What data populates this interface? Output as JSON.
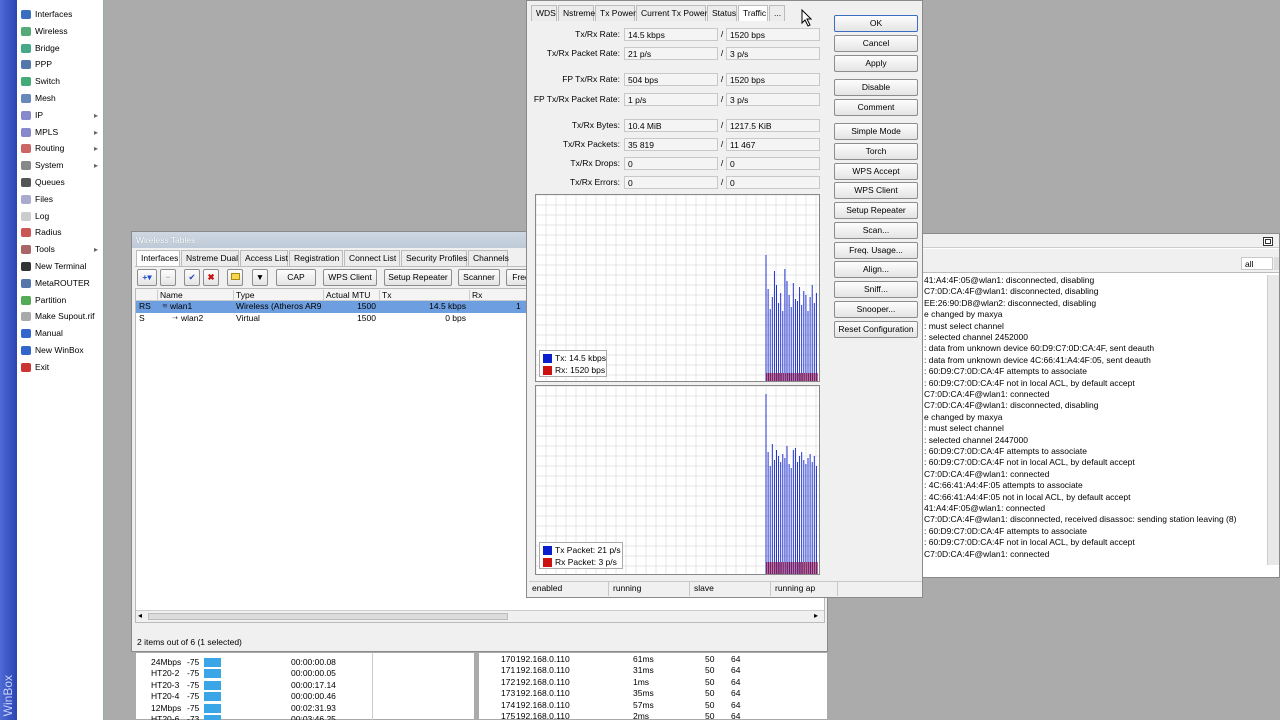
{
  "app_label": "WinBox",
  "menu": {
    "items": [
      {
        "label": "Interfaces",
        "arrow": false,
        "color": "#3a6ec0"
      },
      {
        "label": "Wireless",
        "arrow": false,
        "color": "#5a7"
      },
      {
        "label": "Bridge",
        "arrow": false,
        "color": "#4a8"
      },
      {
        "label": "PPP",
        "arrow": false,
        "color": "#57a"
      },
      {
        "label": "Switch",
        "arrow": false,
        "color": "#4a7"
      },
      {
        "label": "Mesh",
        "arrow": false,
        "color": "#68b"
      },
      {
        "label": "IP",
        "arrow": true,
        "color": "#88c"
      },
      {
        "label": "MPLS",
        "arrow": true,
        "color": "#88c"
      },
      {
        "label": "Routing",
        "arrow": true,
        "color": "#c66"
      },
      {
        "label": "System",
        "arrow": true,
        "color": "#888"
      },
      {
        "label": "Queues",
        "arrow": false,
        "color": "#555"
      },
      {
        "label": "Files",
        "arrow": false,
        "color": "#aac"
      },
      {
        "label": "Log",
        "arrow": false,
        "color": "#ccc"
      },
      {
        "label": "Radius",
        "arrow": false,
        "color": "#c55"
      },
      {
        "label": "Tools",
        "arrow": true,
        "color": "#a66"
      },
      {
        "label": "New Terminal",
        "arrow": false,
        "color": "#333"
      },
      {
        "label": "MetaROUTER",
        "arrow": false,
        "color": "#57a"
      },
      {
        "label": "Partition",
        "arrow": false,
        "color": "#5a5"
      },
      {
        "label": "Make Supout.rif",
        "arrow": false,
        "color": "#aaa"
      },
      {
        "label": "Manual",
        "arrow": false,
        "color": "#36c"
      },
      {
        "label": "New WinBox",
        "arrow": false,
        "color": "#36c"
      },
      {
        "label": "Exit",
        "arrow": false,
        "color": "#c33"
      }
    ]
  },
  "wireless_tables": {
    "title": "Wireless Tables",
    "tabs": [
      "Interfaces",
      "Nstreme Dual",
      "Access List",
      "Registration",
      "Connect List",
      "Security Profiles",
      "Channels"
    ],
    "toolbar": {
      "cap": "CAP",
      "wps_client": "WPS Client",
      "setup_repeater": "Setup Repeater",
      "scanner": "Scanner",
      "freq": "Freq"
    },
    "columns": [
      "Name",
      "Type",
      "Actual MTU",
      "Tx",
      "Rx"
    ],
    "rows": [
      {
        "flags": "RS",
        "name": "wlan1",
        "type": "Wireless (Atheros AR9...",
        "mtu": "1500",
        "tx": "14.5 kbps",
        "rx": "1"
      },
      {
        "flags": "S",
        "name": "wlan2",
        "type": "Virtual",
        "mtu": "1500",
        "tx": "0 bps",
        "rx": ""
      }
    ],
    "status": "2 items out of 6 (1 selected)"
  },
  "iface_window": {
    "tabs": [
      "WDS",
      "Nstreme",
      "Tx Power",
      "Current Tx Power",
      "Status",
      "Traffic",
      "..."
    ],
    "fields": [
      {
        "label": "Tx/Rx Rate:",
        "tx": "14.5 kbps",
        "rx": "1520 bps"
      },
      {
        "label": "Tx/Rx Packet Rate:",
        "tx": "21 p/s",
        "rx": "3 p/s"
      },
      {
        "label": "FP Tx/Rx Rate:",
        "tx": "504 bps",
        "rx": "1520 bps"
      },
      {
        "label": "FP Tx/Rx Packet Rate:",
        "tx": "1 p/s",
        "rx": "3 p/s"
      },
      {
        "label": "Tx/Rx Bytes:",
        "tx": "10.4 MiB",
        "rx": "1217.5 KiB"
      },
      {
        "label": "Tx/Rx Packets:",
        "tx": "35 819",
        "rx": "11 467"
      },
      {
        "label": "Tx/Rx Drops:",
        "tx": "0",
        "rx": "0"
      },
      {
        "label": "Tx/Rx Errors:",
        "tx": "0",
        "rx": "0"
      }
    ],
    "slash": "/",
    "graph1_legend": {
      "tx": "Tx:  14.5 kbps",
      "rx": "Rx:  1520 bps"
    },
    "graph2_legend": {
      "tx": "Tx Packet:  21 p/s",
      "rx": "Rx Packet:  3 p/s"
    },
    "buttons": [
      "OK",
      "Cancel",
      "Apply",
      "Disable",
      "Comment",
      "Simple Mode",
      "Torch",
      "WPS Accept",
      "WPS Client",
      "Setup Repeater",
      "Scan...",
      "Freq. Usage...",
      "Align...",
      "Sniff...",
      "Snooper...",
      "Reset Configuration"
    ],
    "status": [
      "enabled",
      "running",
      "slave",
      "running ap"
    ],
    "colors": {
      "tx": "#0a1fcc",
      "rx": "#cc1111"
    }
  },
  "log_window": {
    "filter_value": "all",
    "lines": [
      "41:A4:4F:05@wlan1: disconnected, disabling",
      "C7:0D:CA:4F@wlan1: disconnected, disabling",
      "EE:26:90:D8@wlan2: disconnected, disabling",
      "e changed by maxya",
      ": must select channel",
      ": selected channel 2452000",
      ": data from unknown device 60:D9:C7:0D:CA:4F, sent deauth",
      ": data from unknown device 4C:66:41:A4:4F:05, sent deauth",
      ": 60:D9:C7:0D:CA:4F attempts to associate",
      ": 60:D9:C7:0D:CA:4F not in local ACL, by default accept",
      "C7:0D:CA:4F@wlan1: connected",
      "C7:0D:CA:4F@wlan1: disconnected, disabling",
      "e changed by maxya",
      ": must select channel",
      ": selected channel 2447000",
      ": 60:D9:C7:0D:CA:4F attempts to associate",
      ": 60:D9:C7:0D:CA:4F not in local ACL, by default accept",
      "C7:0D:CA:4F@wlan1: connected",
      ": 4C:66:41:A4:4F:05 attempts to associate",
      ": 4C:66:41:A4:4F:05 not in local ACL, by default accept",
      "41:A4:4F:05@wlan1: connected",
      "C7:0D:CA:4F@wlan1: disconnected, received disassoc: sending station leaving (8)",
      ": 60:D9:C7:0D:CA:4F attempts to associate",
      ": 60:D9:C7:0D:CA:4F not in local ACL, by default accept",
      "C7:0D:CA:4F@wlan1: connected"
    ]
  },
  "bottom_left_rows": [
    {
      "rate": "24Mbps",
      "signal": "-75",
      "time": "00:00:00.08"
    },
    {
      "rate": "HT20-2",
      "signal": "-75",
      "time": "00:00:00.05"
    },
    {
      "rate": "HT20-3",
      "signal": "-75",
      "time": "00:00:17.14"
    },
    {
      "rate": "HT20-4",
      "signal": "-75",
      "time": "00:00:00.46"
    },
    {
      "rate": "12Mbps",
      "signal": "-75",
      "time": "00:02:31.93"
    },
    {
      "rate": "HT20-6",
      "signal": "-73",
      "time": "00:03:46.25"
    }
  ],
  "bottom_right_rows": [
    {
      "seq": "170",
      "host": "192.168.0.110",
      "time": "61ms",
      "size": "50",
      "ttl": "64"
    },
    {
      "seq": "171",
      "host": "192.168.0.110",
      "time": "31ms",
      "size": "50",
      "ttl": "64"
    },
    {
      "seq": "172",
      "host": "192.168.0.110",
      "time": "1ms",
      "size": "50",
      "ttl": "64"
    },
    {
      "seq": "173",
      "host": "192.168.0.110",
      "time": "35ms",
      "size": "50",
      "ttl": "64"
    },
    {
      "seq": "174",
      "host": "192.168.0.110",
      "time": "57ms",
      "size": "50",
      "ttl": "64"
    },
    {
      "seq": "175",
      "host": "192.168.0.110",
      "time": "2ms",
      "size": "50",
      "ttl": "64"
    }
  ]
}
